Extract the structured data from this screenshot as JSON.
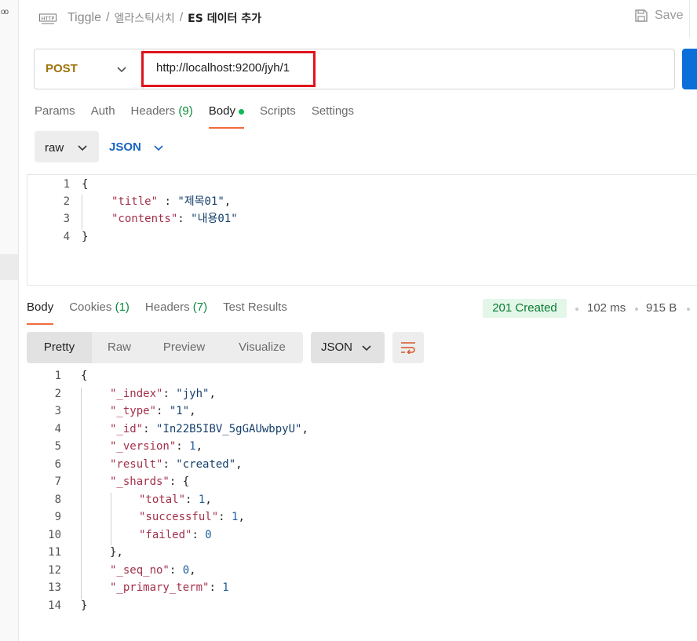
{
  "left_strip": {
    "dots_text": "oo"
  },
  "header": {
    "http_icon_text": "HTTP",
    "breadcrumb": [
      "Tiggle",
      "엘라스틱서치",
      "ES 데이터 추가"
    ],
    "separator": "/",
    "save_label": "Save"
  },
  "request": {
    "method": "POST",
    "url": "http://localhost:9200/jyh/1",
    "tabs": [
      "Params",
      "Auth",
      "Headers",
      "Body",
      "Scripts",
      "Settings"
    ],
    "headers_count": "(9)",
    "body_type": "raw",
    "body_format": "JSON",
    "body_lines": [
      {
        "n": "1",
        "text": "{"
      },
      {
        "n": "2",
        "key": "\"title\"",
        "sep": " : ",
        "val": "\"제목01\"",
        "end": ","
      },
      {
        "n": "3",
        "key": "\"contents\"",
        "sep": ": ",
        "val": "\"내용01\"",
        "end": ""
      },
      {
        "n": "4",
        "text": "}"
      }
    ]
  },
  "response": {
    "tabs": [
      "Body",
      "Cookies",
      "Headers",
      "Test Results"
    ],
    "cookies_count": "(1)",
    "headers_count": "(7)",
    "status": "201 Created",
    "time": "102 ms",
    "size": "915 B",
    "views": [
      "Pretty",
      "Raw",
      "Preview",
      "Visualize"
    ],
    "format": "JSON",
    "lines": [
      {
        "n": "1",
        "text": "{"
      },
      {
        "n": "2",
        "key": "\"_index\"",
        "val": "\"jyh\"",
        "end": ","
      },
      {
        "n": "3",
        "key": "\"_type\"",
        "val": "\"1\"",
        "end": ","
      },
      {
        "n": "4",
        "key": "\"_id\"",
        "val": "\"In22B5IBV_5gGAUwbpyU\"",
        "end": ","
      },
      {
        "n": "5",
        "key": "\"_version\"",
        "num": "1",
        "end": ","
      },
      {
        "n": "6",
        "key": "\"result\"",
        "val": "\"created\"",
        "end": ","
      },
      {
        "n": "7",
        "key": "\"_shards\"",
        "open": "{"
      },
      {
        "n": "8",
        "key": "\"total\"",
        "num": "1",
        "end": ",",
        "indent": 2
      },
      {
        "n": "9",
        "key": "\"successful\"",
        "num": "1",
        "end": ",",
        "indent": 2
      },
      {
        "n": "10",
        "key": "\"failed\"",
        "num": "0",
        "end": "",
        "indent": 2
      },
      {
        "n": "11",
        "text": "},",
        "indent": 1
      },
      {
        "n": "12",
        "key": "\"_seq_no\"",
        "num": "0",
        "end": ","
      },
      {
        "n": "13",
        "key": "\"_primary_term\"",
        "num": "1",
        "end": ""
      },
      {
        "n": "14",
        "text": "}"
      }
    ]
  }
}
